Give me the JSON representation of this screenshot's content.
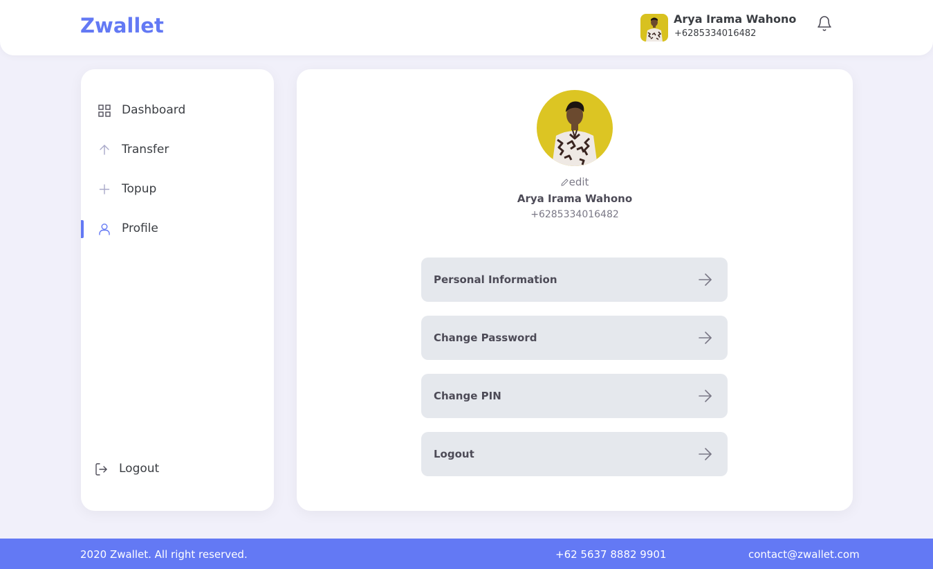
{
  "brand": "Zwallet",
  "colors": {
    "primary": "#6379f4",
    "background": "#f1f0fa",
    "card": "#ffffff",
    "menu_button": "#e5e8ed",
    "text_dark": "#3a3d42",
    "text_muted": "#7a7886"
  },
  "header": {
    "user_name": "Arya Irama Wahono",
    "user_phone": "+6285334016482",
    "notification_icon": "bell-icon"
  },
  "sidebar": {
    "items": [
      {
        "label": "Dashboard",
        "icon": "grid-icon",
        "active": false
      },
      {
        "label": "Transfer",
        "icon": "arrow-up-icon",
        "active": false
      },
      {
        "label": "Topup",
        "icon": "plus-icon",
        "active": false
      },
      {
        "label": "Profile",
        "icon": "user-icon",
        "active": true
      }
    ],
    "logout": {
      "label": "Logout",
      "icon": "logout-icon"
    }
  },
  "profile": {
    "edit_label": "edit",
    "name": "Arya Irama Wahono",
    "phone": "+6285334016482",
    "menu": [
      {
        "label": "Personal Information"
      },
      {
        "label": "Change Password"
      },
      {
        "label": "Change PIN"
      },
      {
        "label": "Logout"
      }
    ]
  },
  "footer": {
    "copyright": "2020 Zwallet. All right reserved.",
    "phone": "+62 5637 8882 9901",
    "email": "contact@zwallet.com"
  }
}
